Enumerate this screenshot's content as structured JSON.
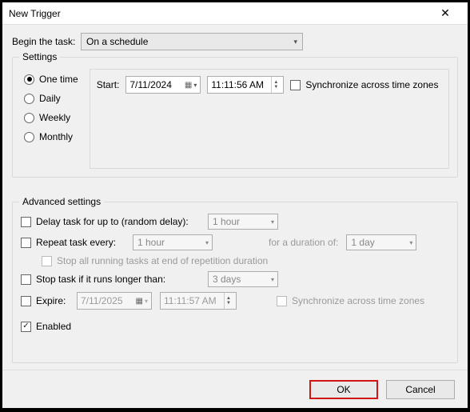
{
  "window": {
    "title": "New Trigger"
  },
  "begin": {
    "label": "Begin the task:",
    "value": "On a schedule"
  },
  "settings": {
    "legend": "Settings",
    "schedule_options": {
      "one_time": "One time",
      "daily": "Daily",
      "weekly": "Weekly",
      "monthly": "Monthly"
    },
    "selected": "one_time",
    "start_label": "Start:",
    "start_date": "7/11/2024",
    "start_time": "11:11:56 AM",
    "sync_zones_label": "Synchronize across time zones",
    "sync_zones_checked": false
  },
  "advanced": {
    "legend": "Advanced settings",
    "delay": {
      "label": "Delay task for up to (random delay):",
      "checked": false,
      "value": "1 hour"
    },
    "repeat": {
      "label": "Repeat task every:",
      "checked": false,
      "value": "1 hour",
      "duration_label": "for a duration of:",
      "duration_value": "1 day"
    },
    "stop_running": {
      "label": "Stop all running tasks at end of repetition duration",
      "checked": false
    },
    "stop_longer": {
      "label": "Stop task if it runs longer than:",
      "checked": false,
      "value": "3 days"
    },
    "expire": {
      "label": "Expire:",
      "checked": false,
      "date": "7/11/2025",
      "time": "11:11:57 AM",
      "sync_label": "Synchronize across time zones",
      "sync_checked": false
    },
    "enabled": {
      "label": "Enabled",
      "checked": true
    }
  },
  "footer": {
    "ok": "OK",
    "cancel": "Cancel"
  }
}
